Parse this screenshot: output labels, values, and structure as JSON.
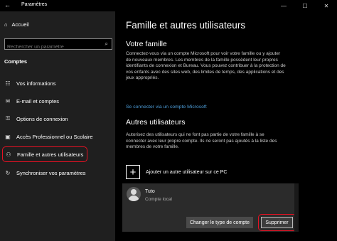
{
  "window": {
    "title": "Paramètres",
    "back_icon": "back-arrow-icon",
    "controls": [
      "minimize-icon",
      "maximize-icon",
      "close-icon"
    ]
  },
  "sidebar": {
    "home_label": "Accueil",
    "search_placeholder": "Rechercher un paramètre",
    "section_label": "Comptes",
    "items": [
      {
        "label": "Vos informations",
        "icon": "person-card-icon"
      },
      {
        "label": "E-mail et comptes",
        "icon": "mail-icon"
      },
      {
        "label": "Options de connexion",
        "icon": "key-icon"
      },
      {
        "label": "Accès Professionnel ou Scolaire",
        "icon": "briefcase-icon"
      },
      {
        "label": "Famille et autres utilisateurs",
        "icon": "people-icon",
        "active": true
      },
      {
        "label": "Synchroniser vos paramètres",
        "icon": "sync-icon"
      }
    ]
  },
  "main": {
    "title": "Famille et autres utilisateurs",
    "family": {
      "heading": "Votre famille",
      "body": "Connectez-vous via un compte Microsoft pour voir votre famille ou y ajouter de nouveaux membres. Les membres de la famille possèdent leur propres identifiants de connexion et Bureau. Vous pouvez contribuer à la protection de vos enfants avec des sites web, des limites de temps, des applications et des jeux appropriés.",
      "link": "Se connecter via un compte Microsoft"
    },
    "others": {
      "heading": "Autres utilisateurs",
      "body": "Autorisez des utilisateurs qui ne font pas partie de votre famille à se connecter avec leur propre compte. Ils ne seront pas ajoutés à la liste des membres de votre famille.",
      "add_label": "Ajouter un autre utilisateur sur ce PC"
    },
    "user": {
      "name": "Tuto",
      "type": "Compte local",
      "change_button": "Changer le type de compte",
      "delete_button": "Supprimer"
    }
  },
  "colors": {
    "highlight": "#e81123",
    "link": "#4c9bd6",
    "accent": "#0078d7"
  }
}
